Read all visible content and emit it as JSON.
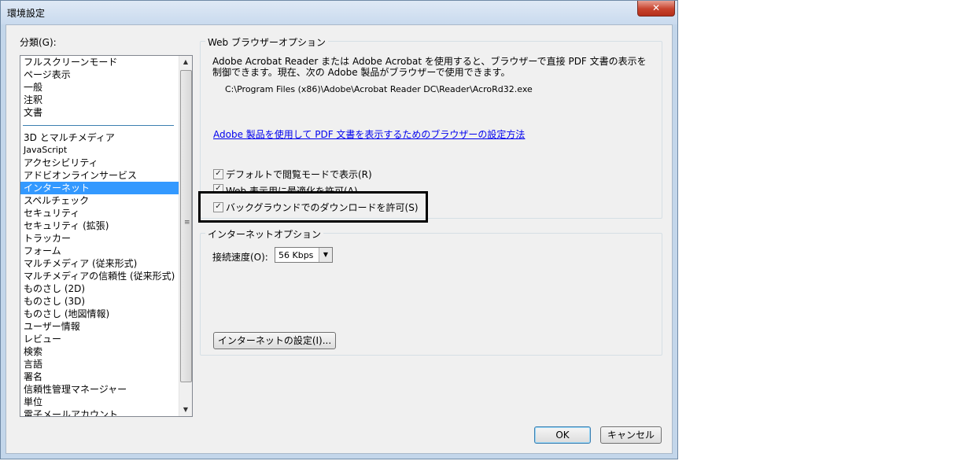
{
  "window": {
    "title": "環境設定",
    "close_label": "✕"
  },
  "categories": {
    "label": "分類(G):",
    "items": [
      {
        "label": "フルスクリーンモード"
      },
      {
        "label": "ページ表示"
      },
      {
        "label": "一般"
      },
      {
        "label": "注釈"
      },
      {
        "label": "文書"
      },
      {
        "separator": true
      },
      {
        "label": "3D とマルチメディア"
      },
      {
        "label": "JavaScript",
        "small": true
      },
      {
        "label": "アクセシビリティ"
      },
      {
        "label": "アドビオンラインサービス"
      },
      {
        "label": "インターネット",
        "selected": true
      },
      {
        "label": "スペルチェック"
      },
      {
        "label": "セキュリティ"
      },
      {
        "label": "セキュリティ (拡張)"
      },
      {
        "label": "トラッカー"
      },
      {
        "label": "フォーム"
      },
      {
        "label": "マルチメディア (従来形式)"
      },
      {
        "label": "マルチメディアの信頼性 (従来形式)"
      },
      {
        "label": "ものさし (2D)"
      },
      {
        "label": "ものさし (3D)"
      },
      {
        "label": "ものさし (地図情報)"
      },
      {
        "label": "ユーザー情報"
      },
      {
        "label": "レビュー"
      },
      {
        "label": "検索"
      },
      {
        "label": "言語"
      },
      {
        "label": "署名"
      },
      {
        "label": "信頼性管理マネージャー"
      },
      {
        "label": "単位"
      },
      {
        "label": "電子メールアカウント"
      }
    ]
  },
  "browser_options": {
    "title": "Web ブラウザーオプション",
    "description_line1": "Adobe Acrobat Reader または Adobe Acrobat を使用すると、ブラウザーで直接 PDF 文書の表示を",
    "description_line2": "制御できます。現在、次の Adobe 製品がブラウザーで使用できます。",
    "path": "C:\\Program Files (x86)\\Adobe\\Acrobat Reader DC\\Reader\\AcroRd32.exe",
    "link": "Adobe 製品を使用して PDF 文書を表示するためのブラウザーの設定方法",
    "checkboxes": [
      {
        "label": "デフォルトで閲覧モードで表示(R)",
        "checked": true
      },
      {
        "label": "Web 表示用に最適化を許可(A)",
        "checked": true
      },
      {
        "label": "バックグラウンドでのダウンロードを許可(S)",
        "checked": true
      }
    ]
  },
  "internet_options": {
    "title": "インターネットオプション",
    "speed_label": "接続速度(O):",
    "speed_value": "56 Kbps",
    "settings_button": "インターネットの設定(I)..."
  },
  "buttons": {
    "ok": "OK",
    "cancel": "キャンセル"
  },
  "check_mark": "✓"
}
